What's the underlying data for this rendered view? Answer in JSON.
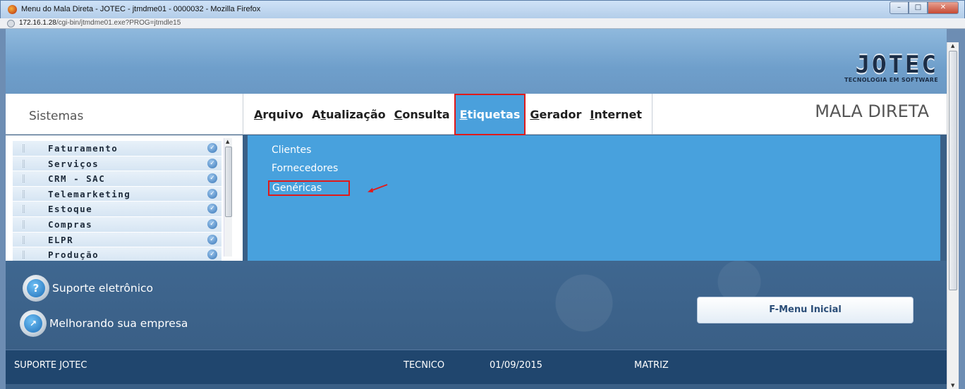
{
  "window": {
    "title": "Menu do Mala Direta - JOTEC - jtmdme01 - 0000032 - Mozilla Firefox",
    "url_host": "172.16.1.28",
    "url_path": "/cgi-bin/jtmdme01.exe?PROG=jtmdle15"
  },
  "logo": {
    "word": "JOTEC",
    "tagline": "TECNOLOGIA EM SOFTWARE"
  },
  "header": {
    "systems_label": "Sistemas",
    "module_title": "MALA DIRETA",
    "menu": [
      {
        "accel": "A",
        "rest": "rquivo",
        "active": false
      },
      {
        "pre": "A",
        "accel": "t",
        "rest": "ualização",
        "active": false
      },
      {
        "accel": "C",
        "rest": "onsulta",
        "active": false
      },
      {
        "accel": "E",
        "rest": "tiquetas",
        "active": true
      },
      {
        "accel": "G",
        "rest": "erador",
        "active": false
      },
      {
        "accel": "I",
        "rest": "nternet",
        "active": false
      }
    ]
  },
  "systems": [
    "Faturamento",
    "Serviços",
    "CRM - SAC",
    "Telemarketing",
    "Estoque",
    "Compras",
    "ELPR",
    "Produção"
  ],
  "dropdown": {
    "items": [
      "Clientes",
      "Fornecedores",
      "Genéricas"
    ],
    "highlighted_index": 2
  },
  "footer": {
    "support_label": "Suporte eletrônico",
    "improve_label": "Melhorando sua empresa",
    "home_button": "F-Menu Inicial"
  },
  "status": {
    "company": "SUPORTE JOTEC",
    "user": "TECNICO",
    "date": "01/09/2015",
    "branch": "MATRIZ"
  },
  "colors": {
    "highlight": "#e01a1a",
    "accent": "#48a1dd",
    "status_bar": "#20466e"
  }
}
